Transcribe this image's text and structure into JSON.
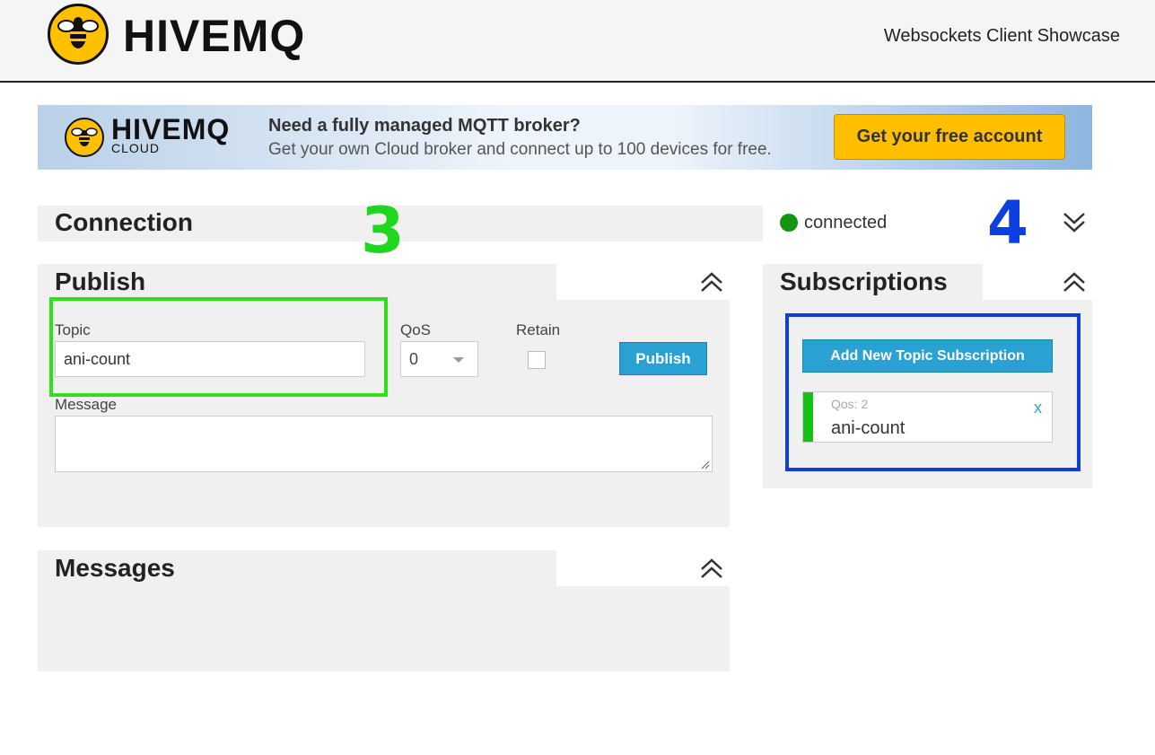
{
  "header": {
    "logo_text": "HIVEMQ",
    "right_title": "Websockets Client Showcase"
  },
  "banner": {
    "logo_text": "HIVEMQ",
    "logo_sub": "CLOUD",
    "headline": "Need a fully managed MQTT broker?",
    "subline": "Get your own Cloud broker and connect up to 100 devices for free.",
    "cta_label": "Get your free account"
  },
  "connection": {
    "title": "Connection",
    "status_text": "connected",
    "status_color": "#119611"
  },
  "annotations": {
    "green_number": "3",
    "blue_number": "4",
    "green_color": "#2ee016",
    "blue_color": "#0b3fd6"
  },
  "publish": {
    "title": "Publish",
    "topic_label": "Topic",
    "topic_value": "ani-count",
    "qos_label": "QoS",
    "qos_value": "0",
    "retain_label": "Retain",
    "retain_checked": false,
    "publish_button": "Publish",
    "message_label": "Message",
    "message_value": ""
  },
  "messages": {
    "title": "Messages"
  },
  "subscriptions": {
    "title": "Subscriptions",
    "add_button": "Add New Topic Subscription",
    "items": [
      {
        "qos_text": "Qos: 2",
        "topic": "ani-count",
        "close_label": "x",
        "color": "#15c215"
      }
    ]
  },
  "icons": {
    "collapse": "double-chevron-up-icon",
    "expand": "double-chevron-down-icon",
    "logo": "bee-icon"
  }
}
